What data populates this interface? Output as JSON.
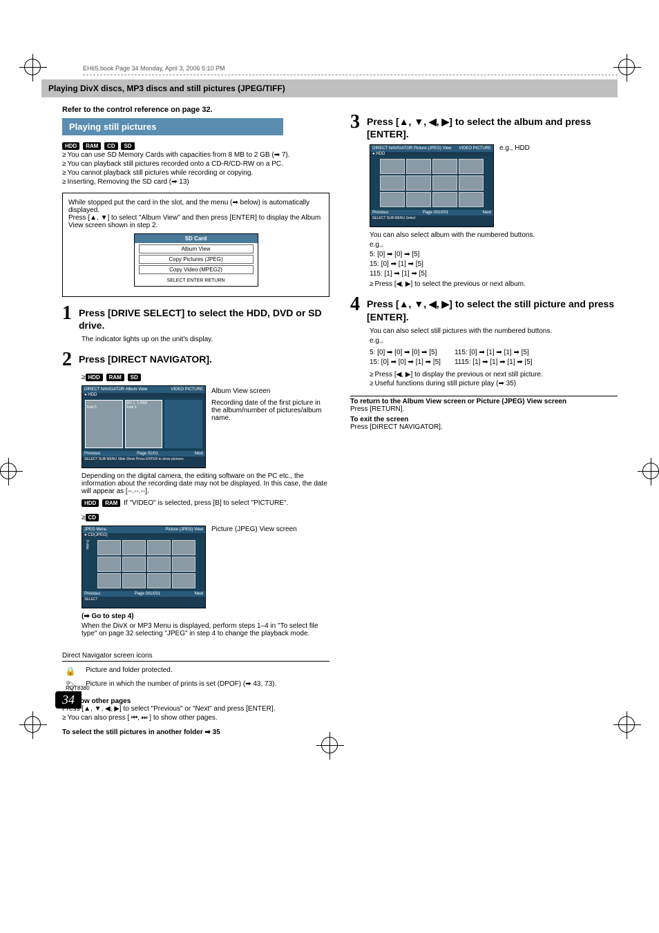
{
  "book_header": "EH65.book  Page 34  Monday, April 3, 2006  5:10 PM",
  "section_header": "Playing DivX discs, MP3 discs and still pictures (JPEG/TIFF)",
  "refer_line": "Refer to the control reference on page 32.",
  "subheader": "Playing still pictures",
  "media_badges": [
    "HDD",
    "RAM",
    "CD",
    "SD"
  ],
  "intro_bullets": [
    "You can use SD Memory Cards with capacities from 8 MB to 2 GB (➡ 7).",
    "You can playback still pictures recorded onto a CD-R/CD-RW on a PC.",
    "You cannot playback still pictures while recording or copying.",
    "Inserting, Removing the SD card (➡ 13)"
  ],
  "callout": {
    "line1": "While stopped put the card in the slot, and the menu (➡ below) is automatically displayed.",
    "line2": "Press [▲, ▼] to select \"Album View\" and then press [ENTER] to display the Album View screen shown in step 2.",
    "menu_title": "SD Card",
    "menu_items": [
      "Album View",
      "Copy Pictures (JPEG)",
      "Copy Video (MPEG2)"
    ],
    "menu_foot": "SELECT   ENTER   RETURN"
  },
  "steps": {
    "s1": {
      "num": "1",
      "title": "Press [DRIVE SELECT] to select the HDD, DVD or SD drive.",
      "body": "The indicator lights up on the unit's display."
    },
    "s2": {
      "num": "2",
      "title": "Press [DIRECT NAVIGATOR].",
      "badges_line": [
        "HDD",
        "RAM",
        "SD"
      ],
      "nav": {
        "head_left": "DIRECT NAVIGATOR   Album View",
        "head_right": "VIDEO  PICTURE",
        "hdd": "HDD",
        "thumb1_date": "- - -",
        "thumb1_name": "Total 5",
        "thumb1_sub": "Total 5",
        "thumb2_date": "001 1. 1.2006",
        "thumb2_name": "Total 3",
        "prev": "Previous",
        "page": "Page 01/01",
        "next": "Next",
        "foot": "SELECT   SUB MENU   Slide Show   Press ENTER to show pictures."
      },
      "caption_title": "Album View screen",
      "caption_body": "Recording date of the first picture in the album/number of pictures/album name.",
      "depending": "Depending on the digital camera, the editing software on the PC etc., the information about the recording date may not be displayed. In this case, the date will appear as [--.--.--].",
      "video_note_badges": [
        "HDD",
        "RAM"
      ],
      "video_note": "If \"VIDEO\" is selected, press [B] to select \"PICTURE\".",
      "cd_badge": "CD",
      "jpeg_menu": {
        "head_left": "JPEG Menu",
        "head_sub": "CD(JPEG)",
        "head_right": "Picture (JPEG) View",
        "folder": "Folder",
        "prev": "Previous",
        "page": "Page 001/001",
        "next": "Next"
      },
      "jpeg_caption": "Picture (JPEG) View screen",
      "goto": "(➡ Go to step 4)",
      "divx_note": "When the DivX or MP3 Menu is displayed, perform steps 1–4 in \"To select file type\" on page 32 selecting \"JPEG\" in step 4 to change the playback mode."
    },
    "s3": {
      "num": "3",
      "title": "Press [▲, ▼, ◀, ▶] to select the album and press [ENTER].",
      "eg": "e.g., HDD",
      "nav": {
        "head_left": "DIRECT NAVIGATOR   Picture (JPEG) View",
        "head_right": "VIDEO  PICTURE",
        "hdd": "HDD",
        "prev": "Previous",
        "page": "Page 001/001",
        "next": "Next",
        "foot": "SELECT   SUB MENU   Select"
      },
      "after1": "You can also select album with the numbered buttons.",
      "eg2": "e.g.,",
      "lines": [
        "5:      [0] ➡ [0] ➡ [5]",
        "15:    [0] ➡ [1] ➡ [5]",
        "115:  [1] ➡ [1] ➡ [5]"
      ],
      "bullet": "Press [◀, ▶] to select the previous or next album."
    },
    "s4": {
      "num": "4",
      "title": "Press [▲, ▼, ◀, ▶] to select the still picture and press [ENTER].",
      "line1": "You can also select still pictures with the numbered buttons.",
      "eg": "e.g.,",
      "pairs": [
        [
          "5:     [0] ➡ [0] ➡ [0] ➡ [5]",
          "115:   [0] ➡ [1] ➡ [1] ➡ [5]"
        ],
        [
          "15:   [0] ➡ [0] ➡ [1] ➡ [5]",
          "1115: [1] ➡ [1] ➡ [1] ➡ [5]"
        ]
      ],
      "bullets": [
        "Press [◀, ▶] to display the previous or next still picture.",
        "Useful functions during still picture play (➡ 35)"
      ]
    }
  },
  "return_block": {
    "h1": "To return to the Album View screen or Picture (JPEG) View screen",
    "b1": "Press [RETURN].",
    "h2": "To exit the screen",
    "b2": "Press [DIRECT NAVIGATOR]."
  },
  "icons_title": "Direct Navigator screen icons",
  "icons": [
    {
      "glyph": "🔒",
      "text": "Picture and folder protected."
    },
    {
      "glyph": "🏷",
      "text": "Picture in which the number of prints is set (DPOF) (➡ 43, 73)."
    }
  ],
  "other_pages": {
    "h": "To show other pages",
    "l1": "Press [▲, ▼, ◀, ▶] to select \"Previous\" or \"Next\" and press [ENTER].",
    "l2": "You can also press [ ⏮, ⏭ ] to show other pages."
  },
  "select_folder": "To select the still pictures in another folder ➡ 35",
  "rqt": "RQT8380",
  "page": "34"
}
